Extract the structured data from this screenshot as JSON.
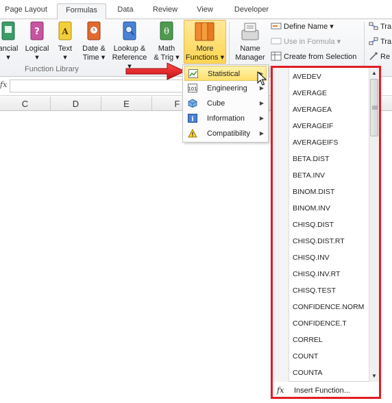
{
  "tabs": [
    {
      "label": "Page Layout",
      "active": false
    },
    {
      "label": "Formulas",
      "active": true
    },
    {
      "label": "Data",
      "active": false
    },
    {
      "label": "Review",
      "active": false
    },
    {
      "label": "View",
      "active": false
    },
    {
      "label": "Developer",
      "active": false
    }
  ],
  "ribbon": {
    "buttons": [
      {
        "label1": "ancial",
        "label2": "▾",
        "icon": "financial-book-icon",
        "color": "#2e8b57"
      },
      {
        "label1": "Logical",
        "label2": "▾",
        "icon": "logical-book-icon",
        "color": "#b23c8c"
      },
      {
        "label1": "Text",
        "label2": "▾",
        "icon": "text-book-icon",
        "color": "#d9b21c"
      },
      {
        "label1": "Date &",
        "label2": "Time ▾",
        "icon": "date-time-book-icon",
        "color": "#d45a1e"
      },
      {
        "label1": "Lookup &",
        "label2": "Reference ▾",
        "icon": "lookup-reference-book-icon",
        "color": "#3a6fc4"
      },
      {
        "label1": "Math",
        "label2": "& Trig ▾",
        "icon": "math-trig-book-icon",
        "color": "#3b8f3b"
      },
      {
        "label1": "More",
        "label2": "Functions ▾",
        "icon": "more-functions-books-icon",
        "color": "#e07a1f"
      }
    ],
    "function_library_label": "Function Library",
    "name_manager": {
      "label1": "Name",
      "label2": "Manager"
    },
    "define_name": "Define Name ▾",
    "use_in_formula": "Use in Formula ▾",
    "create_from_selection": "Create from Selection",
    "trace_1": "Tra",
    "trace_2": "Tra",
    "remove_arrows": "Re"
  },
  "formula_bar": {
    "fx": "fx",
    "value": ""
  },
  "columns": [
    "C",
    "D",
    "E",
    "F"
  ],
  "more_functions_menu": {
    "items": [
      {
        "label": "Statistical",
        "icon": "statistical-chart-icon",
        "selected": true
      },
      {
        "label": "Engineering",
        "icon": "engineering-icon",
        "selected": false
      },
      {
        "label": "Cube",
        "icon": "cube-icon",
        "selected": false
      },
      {
        "label": "Information",
        "icon": "information-icon",
        "selected": false
      },
      {
        "label": "Compatibility",
        "icon": "compatibility-warning-icon",
        "selected": false
      }
    ]
  },
  "statistical_functions": [
    "AVEDEV",
    "AVERAGE",
    "AVERAGEA",
    "AVERAGEIF",
    "AVERAGEIFS",
    "BETA.DIST",
    "BETA.INV",
    "BINOM.DIST",
    "BINOM.INV",
    "CHISQ.DIST",
    "CHISQ.DIST.RT",
    "CHISQ.INV",
    "CHISQ.INV.RT",
    "CHISQ.TEST",
    "CONFIDENCE.NORM",
    "CONFIDENCE.T",
    "CORREL",
    "COUNT",
    "COUNTA"
  ],
  "insert_function": {
    "icon": "fx",
    "label": "Insert Function..."
  },
  "colors": {
    "highlight_border": "#e21b22",
    "arrow": "#e21b22",
    "selection": "#ffe06b"
  }
}
